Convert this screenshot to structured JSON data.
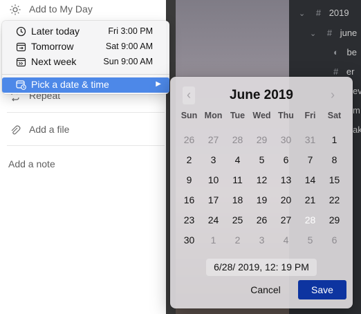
{
  "left_panel": {
    "add_to_my_day": "Add to My Day",
    "repeat": "Repeat",
    "add_file": "Add a file",
    "add_note": "Add a note"
  },
  "menu": {
    "items": [
      {
        "label": "Later today",
        "when": "Fri 3:00 PM",
        "icon": "clock-icon"
      },
      {
        "label": "Tomorrow",
        "when": "Sat 9:00 AM",
        "icon": "calendar-arrow-icon"
      },
      {
        "label": "Next week",
        "when": "Sun 9:00 AM",
        "icon": "calendar-next-week-icon"
      }
    ],
    "pick_label": "Pick a date & time",
    "selected_bg": "#4d88e8"
  },
  "calendar": {
    "title": "June 2019",
    "prev": "‹",
    "next": "›",
    "weekdays": [
      "Sun",
      "Mon",
      "Tue",
      "Wed",
      "Thu",
      "Fri",
      "Sat"
    ],
    "weeks": [
      [
        [
          "26",
          true
        ],
        [
          "27",
          true
        ],
        [
          "28",
          true
        ],
        [
          "29",
          true
        ],
        [
          "30",
          true
        ],
        [
          "31",
          true
        ],
        [
          "1",
          false
        ]
      ],
      [
        [
          "2",
          false
        ],
        [
          "3",
          false
        ],
        [
          "4",
          false
        ],
        [
          "5",
          false
        ],
        [
          "6",
          false
        ],
        [
          "7",
          false
        ],
        [
          "8",
          false
        ]
      ],
      [
        [
          "9",
          false
        ],
        [
          "10",
          false
        ],
        [
          "11",
          false
        ],
        [
          "12",
          false
        ],
        [
          "13",
          false
        ],
        [
          "14",
          false
        ],
        [
          "15",
          false
        ]
      ],
      [
        [
          "16",
          false
        ],
        [
          "17",
          false
        ],
        [
          "18",
          false
        ],
        [
          "19",
          false
        ],
        [
          "20",
          false
        ],
        [
          "21",
          false
        ],
        [
          "22",
          false
        ]
      ],
      [
        [
          "23",
          false
        ],
        [
          "24",
          false
        ],
        [
          "25",
          false
        ],
        [
          "26",
          false
        ],
        [
          "27",
          false
        ],
        [
          "28",
          false
        ],
        [
          "29",
          false
        ]
      ],
      [
        [
          "30",
          false
        ],
        [
          "1",
          true
        ],
        [
          "2",
          true
        ],
        [
          "3",
          true
        ],
        [
          "4",
          true
        ],
        [
          "5",
          true
        ],
        [
          "6",
          true
        ]
      ]
    ],
    "selected_day": "28",
    "datetime_value": "6/28/ 2019, 12: 19 PM",
    "cancel_label": "Cancel",
    "save_label": "Save",
    "accent": "#0d34a0"
  },
  "editor": {
    "lines": [
      {
        "indent": 0,
        "chevron": "⌄",
        "prefix": "#",
        "text": "2019"
      },
      {
        "indent": 1,
        "chevron": "⌄",
        "prefix": "#",
        "text": "june"
      },
      {
        "indent": 2,
        "chevron": "",
        "prefix": "◐",
        "text": "be"
      },
      {
        "indent": 2,
        "chevron": "",
        "prefix": "#",
        "text": "er"
      },
      {
        "indent": 2,
        "chevron": "",
        "prefix": "",
        "text": "ev"
      },
      {
        "indent": 2,
        "chevron": "",
        "prefix": "",
        "text": "m"
      },
      {
        "indent": 2,
        "chevron": "",
        "prefix": "",
        "text": "ak"
      }
    ]
  }
}
